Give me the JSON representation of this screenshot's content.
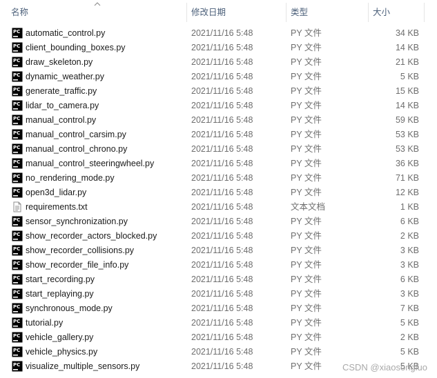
{
  "header": {
    "name_label": "名称",
    "date_label": "修改日期",
    "type_label": "类型",
    "size_label": "大小"
  },
  "files": [
    {
      "name": "automatic_control.py",
      "date": "2021/11/16 5:48",
      "type": "PY 文件",
      "size": "34 KB",
      "icon": "pycharm-file-icon"
    },
    {
      "name": "client_bounding_boxes.py",
      "date": "2021/11/16 5:48",
      "type": "PY 文件",
      "size": "14 KB",
      "icon": "pycharm-file-icon"
    },
    {
      "name": "draw_skeleton.py",
      "date": "2021/11/16 5:48",
      "type": "PY 文件",
      "size": "21 KB",
      "icon": "pycharm-file-icon"
    },
    {
      "name": "dynamic_weather.py",
      "date": "2021/11/16 5:48",
      "type": "PY 文件",
      "size": "5 KB",
      "icon": "pycharm-file-icon"
    },
    {
      "name": "generate_traffic.py",
      "date": "2021/11/16 5:48",
      "type": "PY 文件",
      "size": "15 KB",
      "icon": "pycharm-file-icon"
    },
    {
      "name": "lidar_to_camera.py",
      "date": "2021/11/16 5:48",
      "type": "PY 文件",
      "size": "14 KB",
      "icon": "pycharm-file-icon"
    },
    {
      "name": "manual_control.py",
      "date": "2021/11/16 5:48",
      "type": "PY 文件",
      "size": "59 KB",
      "icon": "pycharm-file-icon"
    },
    {
      "name": "manual_control_carsim.py",
      "date": "2021/11/16 5:48",
      "type": "PY 文件",
      "size": "53 KB",
      "icon": "pycharm-file-icon"
    },
    {
      "name": "manual_control_chrono.py",
      "date": "2021/11/16 5:48",
      "type": "PY 文件",
      "size": "53 KB",
      "icon": "pycharm-file-icon"
    },
    {
      "name": "manual_control_steeringwheel.py",
      "date": "2021/11/16 5:48",
      "type": "PY 文件",
      "size": "36 KB",
      "icon": "pycharm-file-icon"
    },
    {
      "name": "no_rendering_mode.py",
      "date": "2021/11/16 5:48",
      "type": "PY 文件",
      "size": "71 KB",
      "icon": "pycharm-file-icon"
    },
    {
      "name": "open3d_lidar.py",
      "date": "2021/11/16 5:48",
      "type": "PY 文件",
      "size": "12 KB",
      "icon": "pycharm-file-icon"
    },
    {
      "name": "requirements.txt",
      "date": "2021/11/16 5:48",
      "type": "文本文档",
      "size": "1 KB",
      "icon": "text-file-icon"
    },
    {
      "name": "sensor_synchronization.py",
      "date": "2021/11/16 5:48",
      "type": "PY 文件",
      "size": "6 KB",
      "icon": "pycharm-file-icon"
    },
    {
      "name": "show_recorder_actors_blocked.py",
      "date": "2021/11/16 5:48",
      "type": "PY 文件",
      "size": "2 KB",
      "icon": "pycharm-file-icon"
    },
    {
      "name": "show_recorder_collisions.py",
      "date": "2021/11/16 5:48",
      "type": "PY 文件",
      "size": "3 KB",
      "icon": "pycharm-file-icon"
    },
    {
      "name": "show_recorder_file_info.py",
      "date": "2021/11/16 5:48",
      "type": "PY 文件",
      "size": "3 KB",
      "icon": "pycharm-file-icon"
    },
    {
      "name": "start_recording.py",
      "date": "2021/11/16 5:48",
      "type": "PY 文件",
      "size": "6 KB",
      "icon": "pycharm-file-icon"
    },
    {
      "name": "start_replaying.py",
      "date": "2021/11/16 5:48",
      "type": "PY 文件",
      "size": "3 KB",
      "icon": "pycharm-file-icon"
    },
    {
      "name": "synchronous_mode.py",
      "date": "2021/11/16 5:48",
      "type": "PY 文件",
      "size": "7 KB",
      "icon": "pycharm-file-icon"
    },
    {
      "name": "tutorial.py",
      "date": "2021/11/16 5:48",
      "type": "PY 文件",
      "size": "5 KB",
      "icon": "pycharm-file-icon"
    },
    {
      "name": "vehicle_gallery.py",
      "date": "2021/11/16 5:48",
      "type": "PY 文件",
      "size": "2 KB",
      "icon": "pycharm-file-icon"
    },
    {
      "name": "vehicle_physics.py",
      "date": "2021/11/16 5:48",
      "type": "PY 文件",
      "size": "5 KB",
      "icon": "pycharm-file-icon"
    },
    {
      "name": "visualize_multiple_sensors.py",
      "date": "2021/11/16 5:48",
      "type": "PY 文件",
      "size": "5 KB",
      "icon": "pycharm-file-icon"
    }
  ],
  "watermark": "CSDN @xiaosongluo"
}
